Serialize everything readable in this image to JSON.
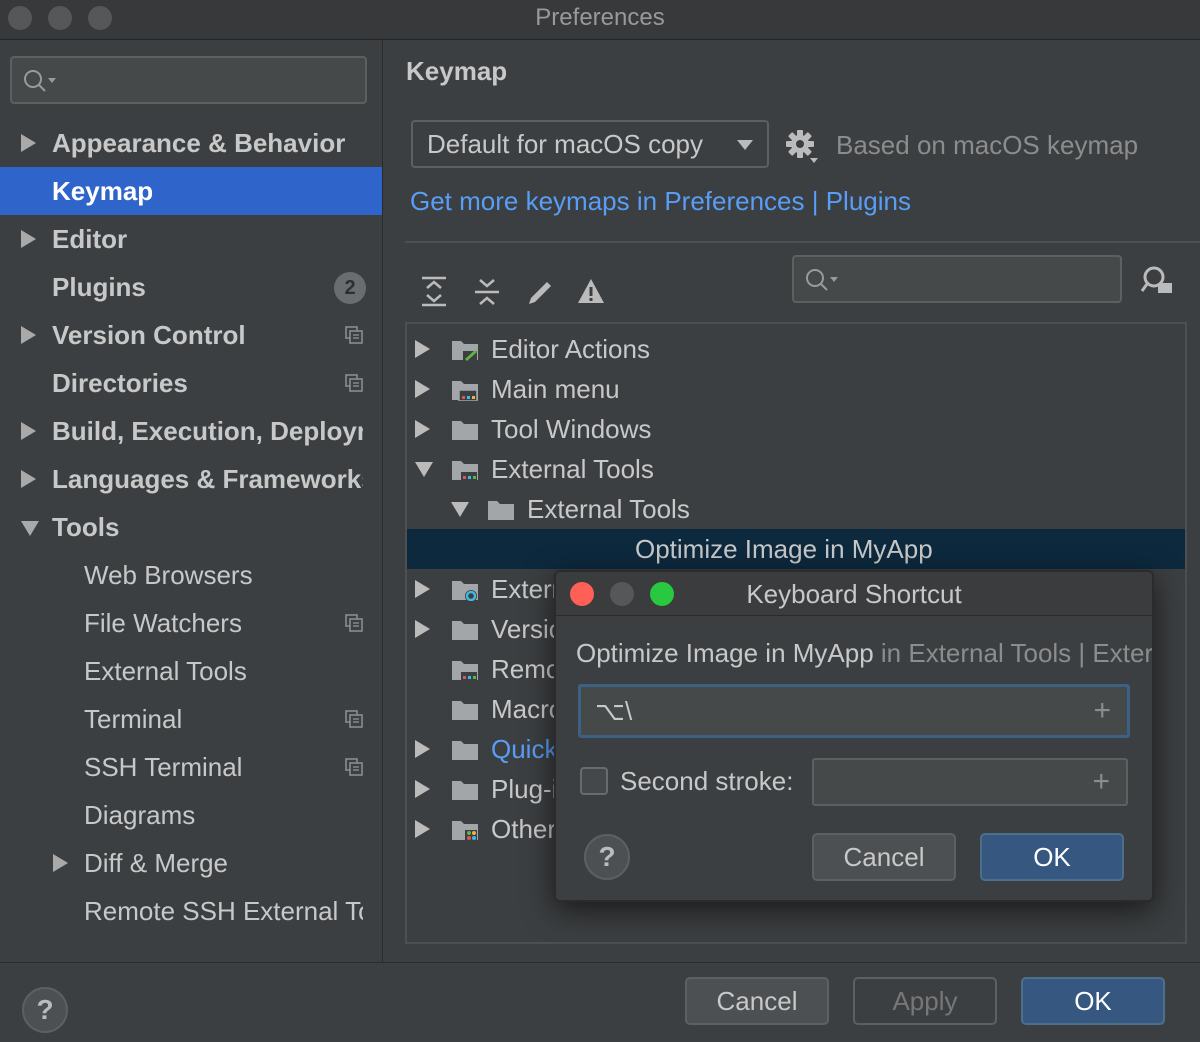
{
  "window": {
    "title": "Preferences"
  },
  "sidebar": {
    "search_placeholder": "",
    "items": [
      {
        "label": "Appearance & Behavior",
        "level": 0,
        "arrow": "right",
        "bold": true
      },
      {
        "label": "Keymap",
        "level": 0,
        "arrow": "none",
        "bold": true,
        "selected": true
      },
      {
        "label": "Editor",
        "level": 0,
        "arrow": "right",
        "bold": true
      },
      {
        "label": "Plugins",
        "level": 0,
        "arrow": "none",
        "bold": true,
        "badge": "2"
      },
      {
        "label": "Version Control",
        "level": 0,
        "arrow": "right",
        "bold": true,
        "copy_icon": true
      },
      {
        "label": "Directories",
        "level": 0,
        "arrow": "none",
        "bold": true,
        "copy_icon": true
      },
      {
        "label": "Build, Execution, Deployment",
        "level": 0,
        "arrow": "right",
        "bold": true
      },
      {
        "label": "Languages & Frameworks",
        "level": 0,
        "arrow": "right",
        "bold": true
      },
      {
        "label": "Tools",
        "level": 0,
        "arrow": "down",
        "bold": true
      },
      {
        "label": "Web Browsers",
        "level": 1,
        "arrow": "none"
      },
      {
        "label": "File Watchers",
        "level": 1,
        "arrow": "none",
        "copy_icon": true
      },
      {
        "label": "External Tools",
        "level": 1,
        "arrow": "none"
      },
      {
        "label": "Terminal",
        "level": 1,
        "arrow": "none",
        "copy_icon": true
      },
      {
        "label": "SSH Terminal",
        "level": 1,
        "arrow": "none",
        "copy_icon": true
      },
      {
        "label": "Diagrams",
        "level": 1,
        "arrow": "none"
      },
      {
        "label": "Diff & Merge",
        "level": 1,
        "arrow": "right"
      },
      {
        "label": "Remote SSH External Tools",
        "level": 1,
        "arrow": "none"
      }
    ]
  },
  "main": {
    "title": "Keymap",
    "keymap_select": "Default for macOS copy",
    "based_on": "Based on macOS keymap",
    "more_link": "Get more keymaps in Preferences | Plugins",
    "toolbar_icons": [
      "expand-all-icon",
      "collapse-all-icon",
      "edit-icon",
      "warning-icon"
    ],
    "tree_search_placeholder": "",
    "tree": [
      {
        "label": "Editor Actions",
        "depth": 0,
        "arrow": "right",
        "icon": "editor-actions-icon"
      },
      {
        "label": "Main menu",
        "depth": 0,
        "arrow": "right",
        "icon": "main-menu-icon"
      },
      {
        "label": "Tool Windows",
        "depth": 0,
        "arrow": "right",
        "icon": "folder-icon"
      },
      {
        "label": "External Tools",
        "depth": 0,
        "arrow": "down",
        "icon": "external-tools-icon"
      },
      {
        "label": "External Tools",
        "depth": 1,
        "arrow": "down",
        "icon": "folder-icon"
      },
      {
        "label": "Optimize Image in MyApp",
        "depth": 2,
        "arrow": "none",
        "icon": "none",
        "selected": true
      },
      {
        "label": "External Build Systems",
        "depth": 0,
        "arrow": "right",
        "icon": "build-systems-icon"
      },
      {
        "label": "Version Control Systems",
        "depth": 0,
        "arrow": "right",
        "icon": "folder-icon"
      },
      {
        "label": "Remote External Tools",
        "depth": 0,
        "arrow": "none",
        "icon": "external-tools-icon"
      },
      {
        "label": "Macros",
        "depth": 0,
        "arrow": "none",
        "icon": "folder-icon"
      },
      {
        "label": "Quick Lists",
        "depth": 0,
        "arrow": "right",
        "icon": "folder-icon",
        "link": true
      },
      {
        "label": "Plug-ins",
        "depth": 0,
        "arrow": "right",
        "icon": "folder-icon"
      },
      {
        "label": "Other",
        "depth": 0,
        "arrow": "right",
        "icon": "other-icon"
      }
    ]
  },
  "bottom": {
    "help": "?",
    "cancel": "Cancel",
    "apply": "Apply",
    "ok": "OK"
  },
  "dialog": {
    "title": "Keyboard Shortcut",
    "action_name": "Optimize Image in MyApp",
    "action_context": " in External Tools | External Tools",
    "first_stroke": "⌥\\",
    "plus": "+",
    "second_stroke_label": "Second stroke:",
    "second_stroke_checked": false,
    "second_stroke_value": "",
    "help": "?",
    "cancel": "Cancel",
    "ok": "OK"
  },
  "colors": {
    "background": "#3c3f41",
    "selection": "#2f65ca",
    "tree_selection": "#0d293e",
    "link": "#589df6",
    "primary_button": "#365880",
    "close": "#fe5f57",
    "minimize": "#febc2e",
    "zoom": "#28c840"
  }
}
